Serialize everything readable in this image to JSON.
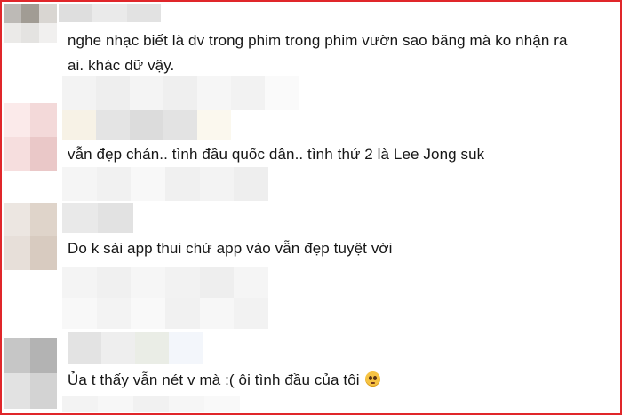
{
  "comments": [
    {
      "line1": "nghe nhạc biết là dv trong phim trong phim vườn sao băng mà ko nhận ra",
      "line2": "ai. khác dữ vậy."
    },
    {
      "line1": "vẫn đẹp chán.. tình đầu quốc dân.. tình thứ 2 là Lee Jong suk"
    },
    {
      "line1": "Do k sài app thui chứ app vào vẫn đẹp tuyệt vời"
    },
    {
      "line1": "Ủa t thấy vẫn nét v mà :( ôi tình đầu của tôi",
      "emoji": "pleading-face-icon"
    }
  ],
  "colors": {
    "border": "#e0262a",
    "text": "#161616"
  }
}
